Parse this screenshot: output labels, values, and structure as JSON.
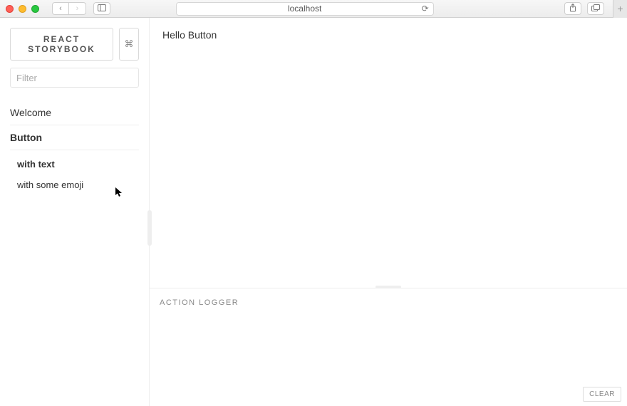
{
  "browser": {
    "url": "localhost",
    "back_glyph": "‹",
    "forward_glyph": "›",
    "reload_glyph": "⟳",
    "share_glyph": "⇪",
    "tabs_glyph": "⧉",
    "newtab_glyph": "+"
  },
  "sidebar": {
    "brand": "REACT STORYBOOK",
    "shortcut_glyph": "⌘",
    "filter_placeholder": "Filter",
    "items": [
      {
        "kind": "Welcome",
        "active": false,
        "stories": []
      },
      {
        "kind": "Button",
        "active": true,
        "stories": [
          {
            "label": "with text",
            "active": true
          },
          {
            "label": "with some emoji",
            "active": false
          }
        ]
      }
    ]
  },
  "preview": {
    "content": "Hello Button"
  },
  "logger": {
    "title": "ACTION LOGGER",
    "clear_label": "CLEAR"
  }
}
